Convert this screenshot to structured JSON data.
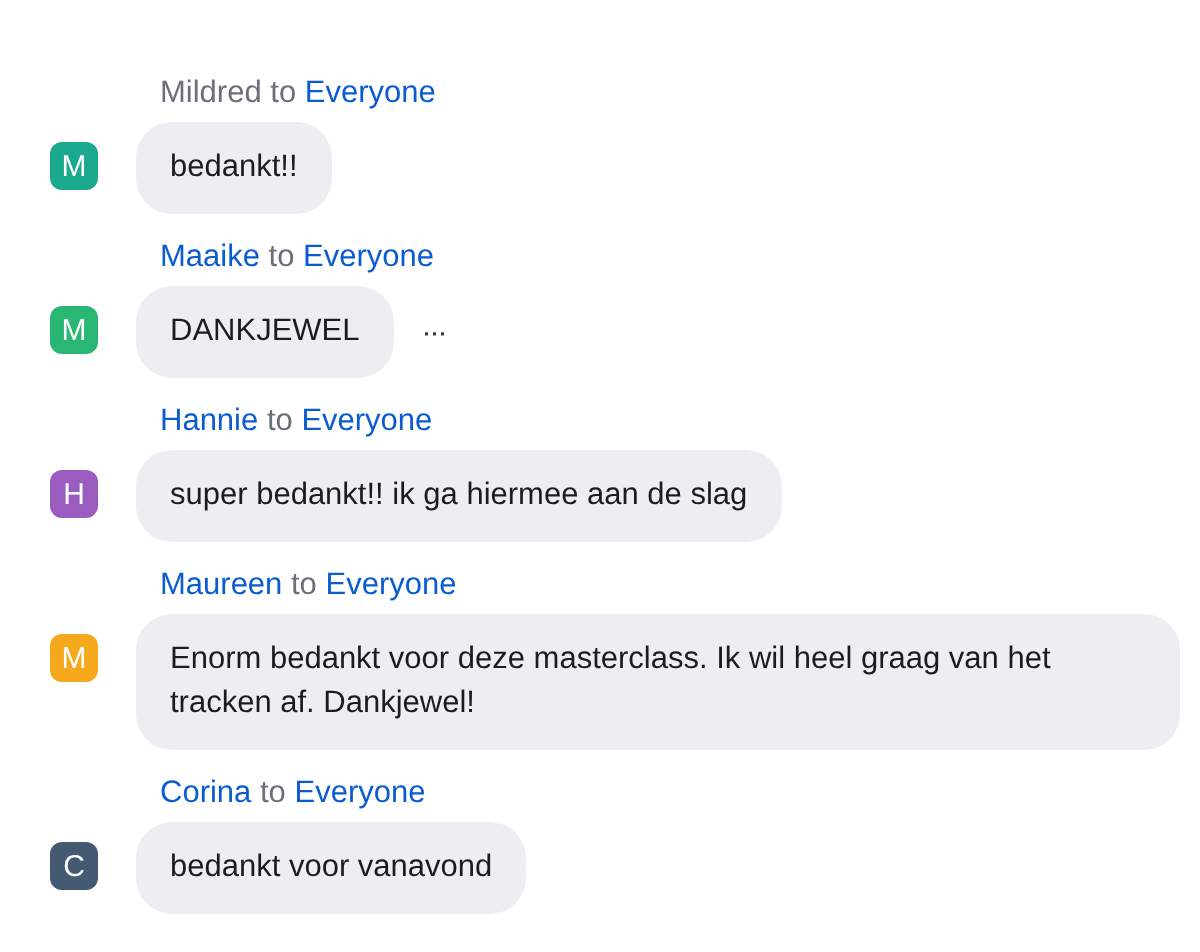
{
  "messages": [
    {
      "sender": "Mildred",
      "sender_is_self": true,
      "connector": "to",
      "recipient": "Everyone",
      "initial": "M",
      "color": "#1aa88f",
      "text": "bedankt!!"
    },
    {
      "sender": "Maaike",
      "sender_is_self": false,
      "connector": "to",
      "recipient": "Everyone",
      "initial": "M",
      "color": "#2ab673",
      "text": "DANKJEWEL",
      "more": "···"
    },
    {
      "sender": "Hannie",
      "sender_is_self": false,
      "connector": "to",
      "recipient": "Everyone",
      "initial": "H",
      "color": "#9b5cc0",
      "text": "super bedankt!! ik ga hiermee aan de slag"
    },
    {
      "sender": "Maureen",
      "sender_is_self": false,
      "connector": "to",
      "recipient": "Everyone",
      "initial": "M",
      "color": "#f5a81c",
      "text": "Enorm bedankt voor deze masterclass. Ik wil heel graag van het tracken af. Dankjewel!"
    },
    {
      "sender": "Corina",
      "sender_is_self": false,
      "connector": "to",
      "recipient": "Everyone",
      "initial": "C",
      "color": "#445a72",
      "text": "bedankt voor vanavond"
    }
  ]
}
